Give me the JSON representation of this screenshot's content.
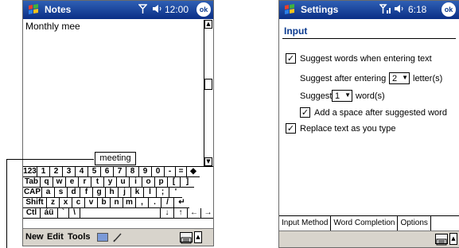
{
  "notes": {
    "app_title": "Notes",
    "time": "12:00",
    "signal_icon": "antenna-icon",
    "volume_icon": "speaker-icon",
    "ok_label": "ok",
    "document_text": "Monthly mee",
    "suggestion": "meeting",
    "keyboard_rows": [
      [
        "123",
        "1",
        "2",
        "3",
        "4",
        "5",
        "6",
        "7",
        "8",
        "9",
        "0",
        "-",
        "=",
        "◆"
      ],
      [
        "Tab",
        "q",
        "w",
        "e",
        "r",
        "t",
        "y",
        "u",
        "i",
        "o",
        "p",
        "[",
        "]"
      ],
      [
        "CAP",
        "a",
        "s",
        "d",
        "f",
        "g",
        "h",
        "j",
        "k",
        "l",
        ";",
        "'"
      ],
      [
        "Shift",
        "z",
        "x",
        "c",
        "v",
        "b",
        "n",
        "m",
        ",",
        ".",
        "/",
        "↵"
      ],
      [
        "Ctl",
        "áü",
        "`",
        "\\",
        "",
        "↓",
        "↑",
        "←",
        "→"
      ]
    ],
    "menu": [
      "New",
      "Edit",
      "Tools"
    ]
  },
  "settings": {
    "app_title": "Settings",
    "time": "6:18",
    "ok_label": "ok",
    "page_heading": "Input",
    "suggest_words_label": "Suggest words when entering text",
    "suggest_words_checked": true,
    "suggest_after_label": "Suggest after entering",
    "suggest_after_value": "2",
    "suggest_after_unit": "letter(s)",
    "suggest_label": "Suggest",
    "suggest_value": "1",
    "suggest_unit": "word(s)",
    "add_space_label": "Add a space after suggested word",
    "add_space_checked": true,
    "replace_label": "Replace text as you type",
    "replace_checked": true,
    "tabs": [
      "Input Method",
      "Word Completion",
      "Options"
    ],
    "active_tab": "Word Completion"
  },
  "colors": {
    "titlebar": "#0b3a8f",
    "heading": "#0b3a8f",
    "menubar": "#d8d4cc"
  }
}
